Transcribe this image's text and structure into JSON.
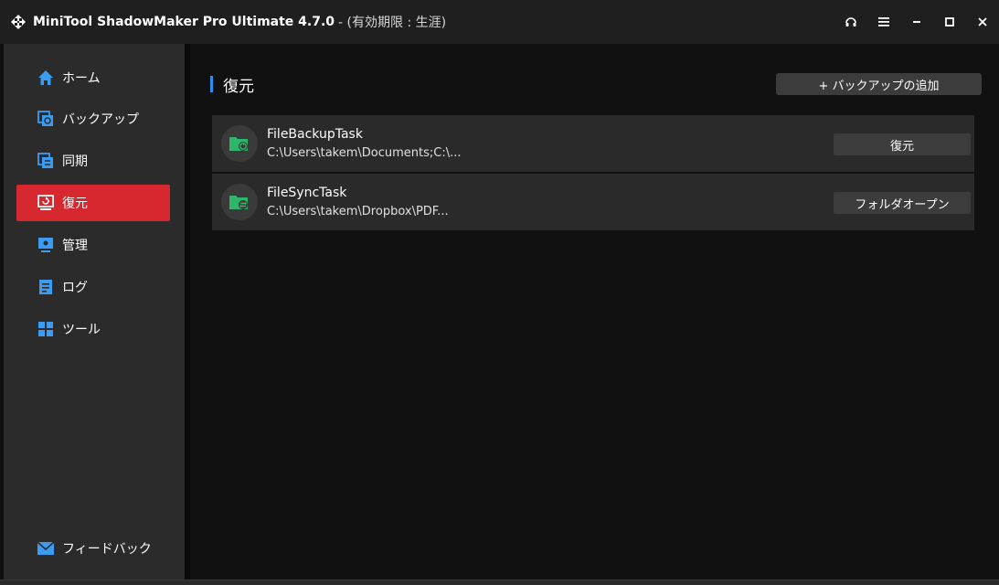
{
  "window": {
    "title": "MiniTool ShadowMaker Pro Ultimate 4.7.0",
    "subtitle": "- (有効期限 : 生涯)",
    "icons": [
      "headset-icon",
      "menu-icon",
      "minimize-icon",
      "maximize-icon",
      "close-icon"
    ]
  },
  "sidebar": {
    "items": [
      {
        "label": "ホーム",
        "icon": "home-icon",
        "active": false
      },
      {
        "label": "バックアップ",
        "icon": "backup-icon",
        "active": false
      },
      {
        "label": "同期",
        "icon": "sync-icon",
        "active": false
      },
      {
        "label": "復元",
        "icon": "restore-icon",
        "active": true
      },
      {
        "label": "管理",
        "icon": "manage-icon",
        "active": false
      },
      {
        "label": "ログ",
        "icon": "log-icon",
        "active": false
      },
      {
        "label": "ツール",
        "icon": "tools-icon",
        "active": false
      }
    ],
    "feedback": {
      "label": "フィードバック",
      "icon": "mail-icon"
    }
  },
  "main": {
    "title": "復元",
    "add_backup_label": "+ バックアップの追加",
    "tasks": [
      {
        "name": "FileBackupTask",
        "path": "C:\\Users\\takem\\Documents;C:\\...",
        "action": "復元",
        "icon": "backup-folder-icon"
      },
      {
        "name": "FileSyncTask",
        "path": "C:\\Users\\takem\\Dropbox\\PDF...",
        "action": "フォルダオープン",
        "icon": "sync-folder-icon"
      }
    ]
  },
  "colors": {
    "accent": "#d7282f",
    "section_marker": "#2d8ff0",
    "folder_green": "#2fb66a",
    "nav_icon_blue": "#3a9cf2"
  }
}
